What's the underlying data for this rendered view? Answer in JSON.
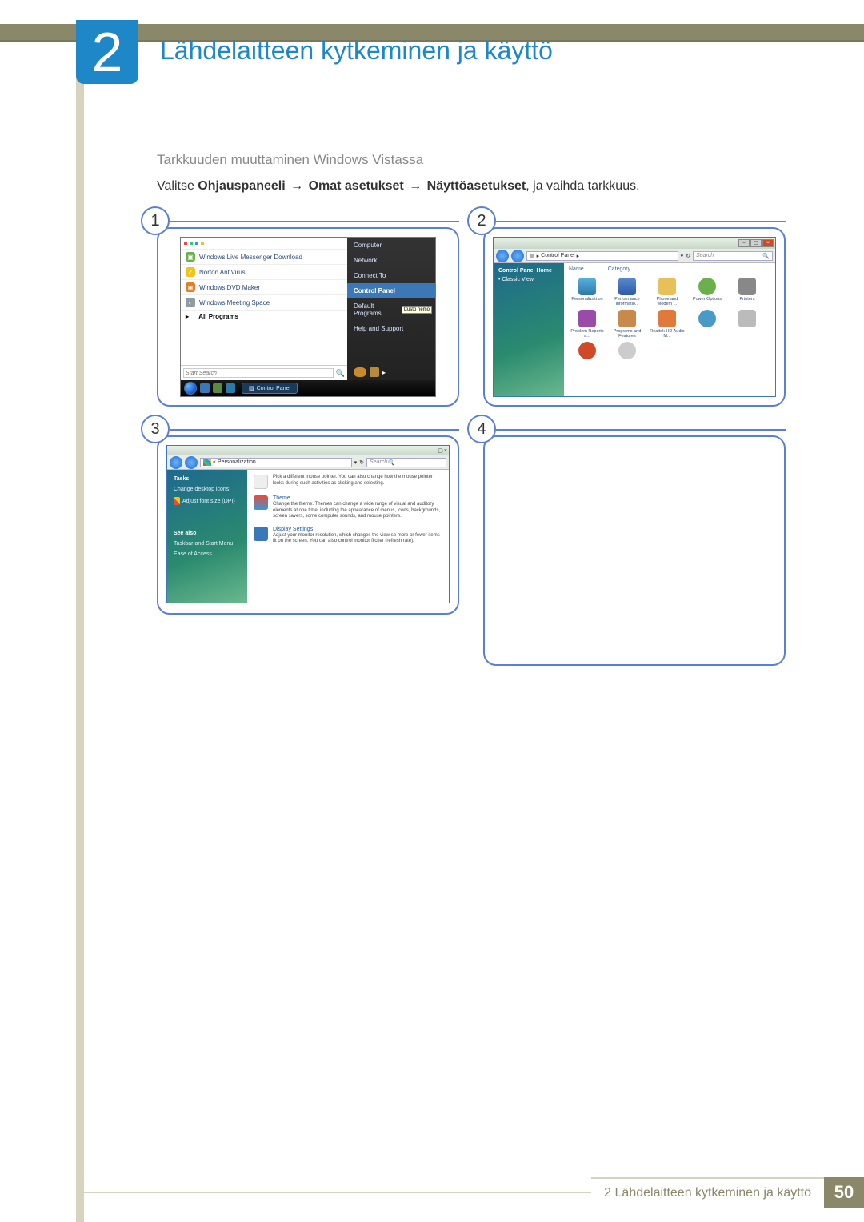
{
  "chapter": {
    "number": "2",
    "title": "Lähdelaitteen kytkeminen ja käyttö"
  },
  "section_title": "Tarkkuuden muuttaminen Windows Vistassa",
  "instruction": {
    "prefix": "Valitse ",
    "path1": "Ohjauspaneeli",
    "path2": "Omat asetukset",
    "path3": "Näyttöasetukset",
    "suffix": ", ja vaihda tarkkuus.",
    "arrow": "→"
  },
  "panels": {
    "n1": "1",
    "n2": "2",
    "n3": "3",
    "n4": "4"
  },
  "shot1": {
    "items": {
      "messenger": "Windows Live Messenger Download",
      "norton": "Norton AntiVirus",
      "dvdmaker": "Windows DVD Maker",
      "meeting": "Windows Meeting Space",
      "allprograms": "All Programs"
    },
    "right": {
      "computer": "Computer",
      "network": "Network",
      "connect": "Connect To",
      "controlpanel": "Control Panel",
      "default": "Default Programs",
      "help": "Help and Support",
      "tooltip": "Custo\nnemo"
    },
    "search_placeholder": "Start Search",
    "taskbar_task": "Control Panel",
    "arrow_right": "▸"
  },
  "shot2": {
    "breadcrumb_sep": "▸",
    "breadcrumb": "Control Panel",
    "refresh": "↻",
    "search": "Search",
    "side": {
      "home": "Control Panel Home",
      "classic": "Classic View"
    },
    "cols": {
      "name": "Name",
      "category": "Category"
    },
    "items": {
      "personalization": "Personalizati\non",
      "performance": "Performance\nInformatio...",
      "phone": "Phone and\nModem ...",
      "power": "Power\nOptions",
      "printers": "Printers",
      "problem": "Problem\nReports a...",
      "programs": "Programs\nand Features",
      "realtek": "Realtek HD\nAudio M..."
    }
  },
  "shot3": {
    "breadcrumb": "Personalization",
    "refresh": "↻",
    "search": "Search",
    "side": {
      "tasks": "Tasks",
      "desktop": "Change desktop icons",
      "dpi": "Adjust font size (DPI)",
      "seealso": "See also",
      "taskbar": "Taskbar and Start Menu",
      "ease": "Ease of Access"
    },
    "entries": {
      "mouse_desc": "Pick a different mouse pointer. You can also change how the mouse pointer looks during such activities as clicking and selecting.",
      "theme_title": "Theme",
      "theme_desc": "Change the theme. Themes can change a wide range of visual and auditory elements at one time, including the appearance of menus, icons, backgrounds, screen savers, some computer sounds, and mouse pointers.",
      "display_title": "Display Settings",
      "display_desc": "Adjust your monitor resolution, which changes the view so more or fewer items fit on the screen. You can also control monitor flicker (refresh rate)."
    }
  },
  "footer": {
    "label": "2 Lähdelaitteen kytkeminen ja käyttö",
    "page": "50"
  }
}
